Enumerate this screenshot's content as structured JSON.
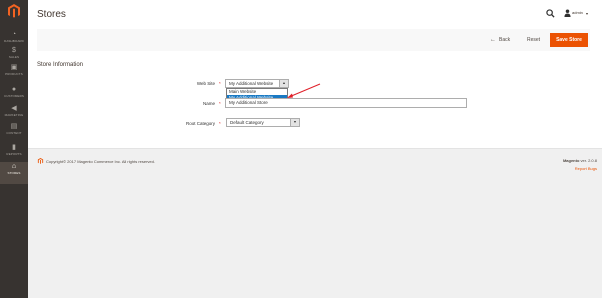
{
  "sidebar": {
    "items": [
      {
        "label": "Dashboard",
        "icon": "dashboard-icon",
        "glyph": "◔"
      },
      {
        "label": "Sales",
        "icon": "dollar-icon",
        "glyph": "$"
      },
      {
        "label": "Products",
        "icon": "cube-icon",
        "glyph": "▣"
      },
      {
        "label": "Customers",
        "icon": "customers-icon",
        "glyph": "●"
      },
      {
        "label": "Marketing",
        "icon": "megaphone-icon",
        "glyph": "◀"
      },
      {
        "label": "Content",
        "icon": "content-icon",
        "glyph": "▤"
      },
      {
        "label": "Reports",
        "icon": "bar-chart-icon",
        "glyph": "▮"
      },
      {
        "label": "Stores",
        "icon": "store-icon",
        "glyph": "⌂"
      }
    ]
  },
  "header": {
    "title": "Stores",
    "user": "admin"
  },
  "actions": {
    "back": "Back",
    "reset": "Reset",
    "save": "Save Store"
  },
  "form": {
    "section_title": "Store Information",
    "website_label": "Web Site",
    "website_value": "My Additional Website",
    "website_options": [
      "Main Website",
      "My Additional Website",
      "My Additional Store"
    ],
    "name_label": "Name",
    "name_value": "My Additional Store",
    "root_category_label": "Root Category",
    "root_category_value": "Default Category",
    "required_mark": "*"
  },
  "footer": {
    "copyright": "Copyright© 2017 Magento Commerce Inc. All rights reserved.",
    "brand": "Magento",
    "version": "ver. 2.0.8",
    "report": "Report Bugs"
  },
  "colors": {
    "accent": "#eb5202",
    "sidebar": "#373330",
    "selected": "#1979c3",
    "annotation_arrow": "#e0202a"
  }
}
